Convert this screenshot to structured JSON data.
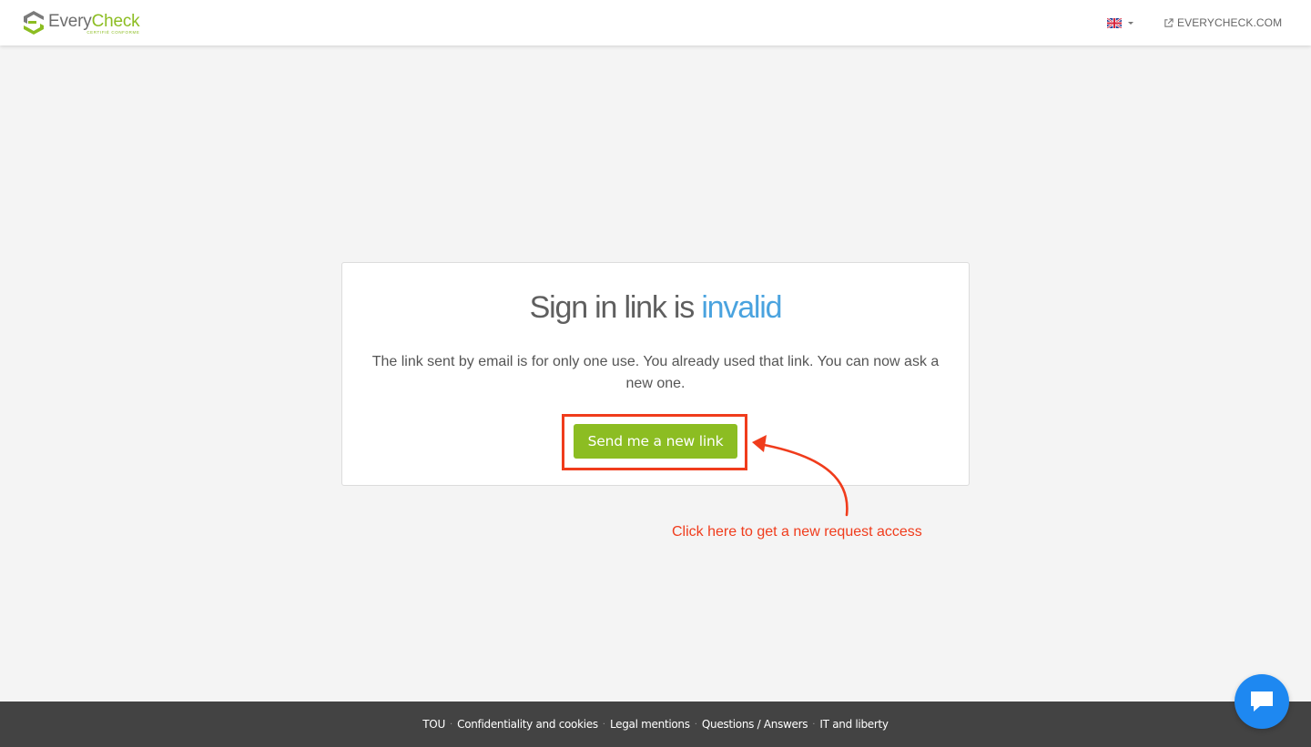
{
  "header": {
    "logo": {
      "word_every": "Every",
      "word_check": "Check",
      "tagline": "CERTIFIÉ CONFORME"
    },
    "language": {
      "current": "English",
      "flag_icon": "uk-flag-icon"
    },
    "site_link": "EVERYCHECK.COM"
  },
  "card": {
    "title_main": "Sign in link is ",
    "title_accent": "invalid",
    "description": "The link sent by email is for only one use. You already used that link. You can now ask a new one.",
    "button_label": "Send me a new link"
  },
  "annotation": {
    "text": "Click here to get a new request access",
    "color": "#f03c1c"
  },
  "footer": {
    "links": [
      "TOU",
      "Confidentiality and cookies",
      "Legal mentions",
      "Questions / Answers",
      "IT and liberty"
    ]
  },
  "colors": {
    "brand_green": "#8cbd22",
    "accent_blue": "#4aa3df",
    "footer_bg": "#434343",
    "chat_blue": "#1e88f1"
  }
}
